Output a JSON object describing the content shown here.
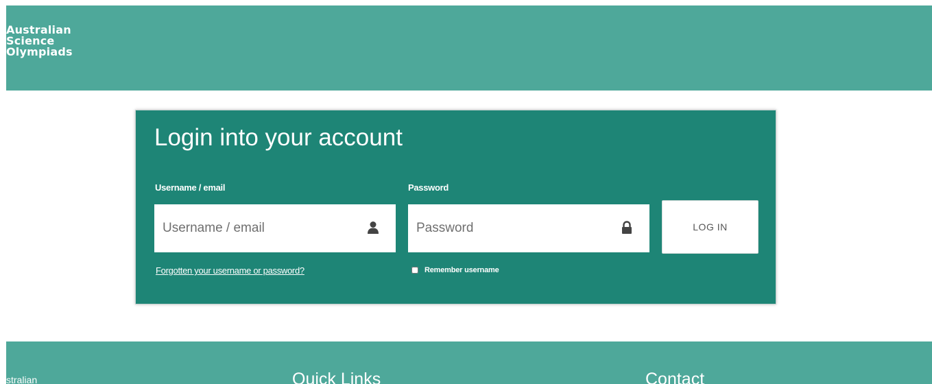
{
  "header": {
    "logo_lines": [
      "Australian",
      "Science",
      "Olympiads"
    ],
    "background_color": "#4ea89a"
  },
  "login": {
    "title": "Login into your account",
    "username": {
      "label": "Username / email",
      "placeholder": "Username / email",
      "value": "",
      "icon": "user-icon"
    },
    "password": {
      "label": "Password",
      "placeholder": "Password",
      "value": "",
      "icon": "lock-icon"
    },
    "login_button_label": "LOG IN",
    "forgot_link": "Forgotten your username or password?",
    "remember_label": "Remember username",
    "remember_checked": false,
    "card_color": "#1e8576"
  },
  "footer": {
    "brand_partial": "stralian",
    "quick_links_heading": "Quick Links",
    "contact_heading": "Contact"
  }
}
